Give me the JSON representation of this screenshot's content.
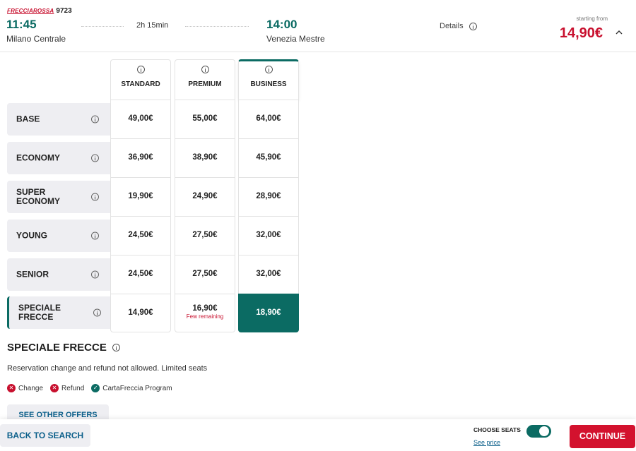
{
  "train": {
    "brand": "FRECCIAROSSA",
    "number": "9723",
    "departure_time": "11:45",
    "departure_station": "Milano Centrale",
    "duration": "2h 15min",
    "arrival_time": "14:00",
    "arrival_station": "Venezia Mestre",
    "details_label": "Details",
    "starting_from_label": "starting from",
    "starting_price": "14,90€"
  },
  "classes": [
    "STANDARD",
    "PREMIUM",
    "BUSINESS"
  ],
  "selected_class": "BUSINESS",
  "fares": [
    {
      "name": "BASE",
      "prices": [
        "49,00€",
        "55,00€",
        "64,00€"
      ],
      "notes": [
        "",
        "",
        ""
      ]
    },
    {
      "name": "ECONOMY",
      "prices": [
        "36,90€",
        "38,90€",
        "45,90€"
      ],
      "notes": [
        "",
        "",
        ""
      ]
    },
    {
      "name": "SUPER ECONOMY",
      "prices": [
        "19,90€",
        "24,90€",
        "28,90€"
      ],
      "notes": [
        "",
        "",
        ""
      ]
    },
    {
      "name": "YOUNG",
      "prices": [
        "24,50€",
        "27,50€",
        "32,00€"
      ],
      "notes": [
        "",
        "",
        ""
      ]
    },
    {
      "name": "SENIOR",
      "prices": [
        "24,50€",
        "27,50€",
        "32,00€"
      ],
      "notes": [
        "",
        "",
        ""
      ]
    },
    {
      "name": "SPECIALE FRECCE",
      "prices": [
        "14,90€",
        "16,90€",
        "18,90€"
      ],
      "notes": [
        "",
        "Few remaining",
        ""
      ]
    }
  ],
  "selected_fare": "SPECIALE FRECCE",
  "offer": {
    "title": "SPECIALE FRECCE",
    "description": "Reservation change and refund not allowed. Limited seats",
    "features": [
      {
        "label": "Change",
        "allowed": false
      },
      {
        "label": "Refund",
        "allowed": false
      },
      {
        "label": "CartaFreccia Program",
        "allowed": true
      }
    ],
    "see_other_offers": "SEE OTHER OFFERS"
  },
  "footer": {
    "back_label": "BACK TO SEARCH",
    "choose_seats_label": "CHOOSE SEATS",
    "choose_seats_enabled": true,
    "see_price_label": "See price",
    "continue_label": "CONTINUE"
  },
  "colors": {
    "accent": "#0b6b63",
    "brand_red": "#c8102e",
    "link": "#0b5f8a"
  }
}
